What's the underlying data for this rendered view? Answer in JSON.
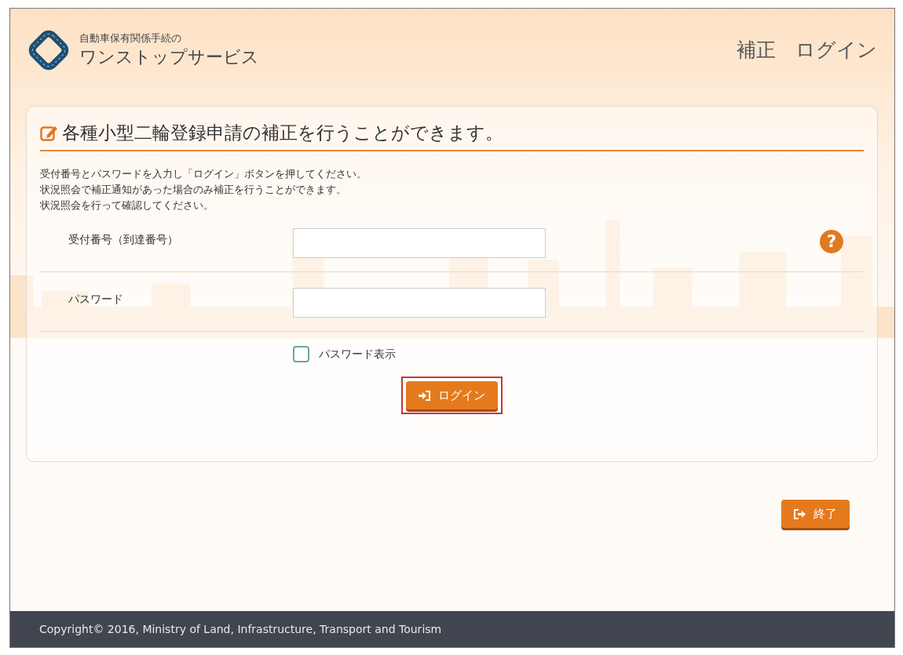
{
  "header": {
    "logo_subtitle": "自動車保有関係手続の",
    "logo_title": "ワンストップサービス",
    "page_title": "補正　ログイン"
  },
  "card": {
    "title": "各種小型二輪登録申請の補正を行うことができます。",
    "instructions": [
      "受付番号とパスワードを入力し「ログイン」ボタンを押してください。",
      "状況照会で補正通知があった場合のみ補正を行うことができます。",
      "状況照会を行って確認してください。"
    ],
    "fields": [
      {
        "label": "受付番号（到達番号）"
      },
      {
        "label": "パスワード"
      }
    ],
    "help_icon": "?",
    "show_password": {
      "label": "パスワード表示",
      "checked": false
    },
    "login_button": {
      "label": "ログイン",
      "highlighted": true
    }
  },
  "exit_button": {
    "label": "終了"
  },
  "footer": {
    "copyright": "Copyright© 2016, Ministry of Land, Infrastructure, Transport and Tourism"
  }
}
